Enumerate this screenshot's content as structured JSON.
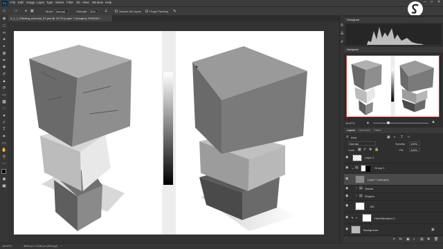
{
  "menubar": {
    "app_logo": "Ps",
    "items": [
      "File",
      "Edit",
      "Image",
      "Layer",
      "Type",
      "Select",
      "Filter",
      "3D",
      "View",
      "Window",
      "Help"
    ]
  },
  "options": {
    "mode_label": "Mode:",
    "mode_value": "Normal",
    "strength_label": "Strength:",
    "strength_value": "30%",
    "sample_all_label": "Sample All Layers",
    "finger_label": "Finger Painting"
  },
  "document": {
    "tab_title": "4_1_1_Painting_exercise_01.psd @ 16.7% (Layer 7 (merged), RGB/16) *"
  },
  "panels": {
    "histogram_tab": "Histogram",
    "navigator_tab": "Navigator",
    "navigator_zoom": "16.67%",
    "layers_tab": "Layers",
    "channels_tab": "Channels",
    "paths_tab": "Paths",
    "kind_label": "Kind",
    "blend_mode": "Normal",
    "opacity_label": "Opacity:",
    "opacity_value": "100%",
    "lock_label": "Lock:",
    "fill_label": "Fill:",
    "fill_value": "100%"
  },
  "layers": [
    {
      "name": "Layer 2",
      "type": "layer"
    },
    {
      "name": "Group 1",
      "type": "group"
    },
    {
      "name": "Layer 7 (merged)",
      "type": "layer"
    },
    {
      "name": "Values",
      "type": "folder"
    },
    {
      "name": "Shapes",
      "type": "folder"
    },
    {
      "name": "BG",
      "type": "layer"
    },
    {
      "name": "Hue/Saturation 1",
      "type": "adjustment"
    },
    {
      "name": "Background",
      "type": "layer"
    }
  ],
  "status": {
    "zoom": "16.67%",
    "doc_info": "3820 px x 2160 px (300 ppi)"
  }
}
